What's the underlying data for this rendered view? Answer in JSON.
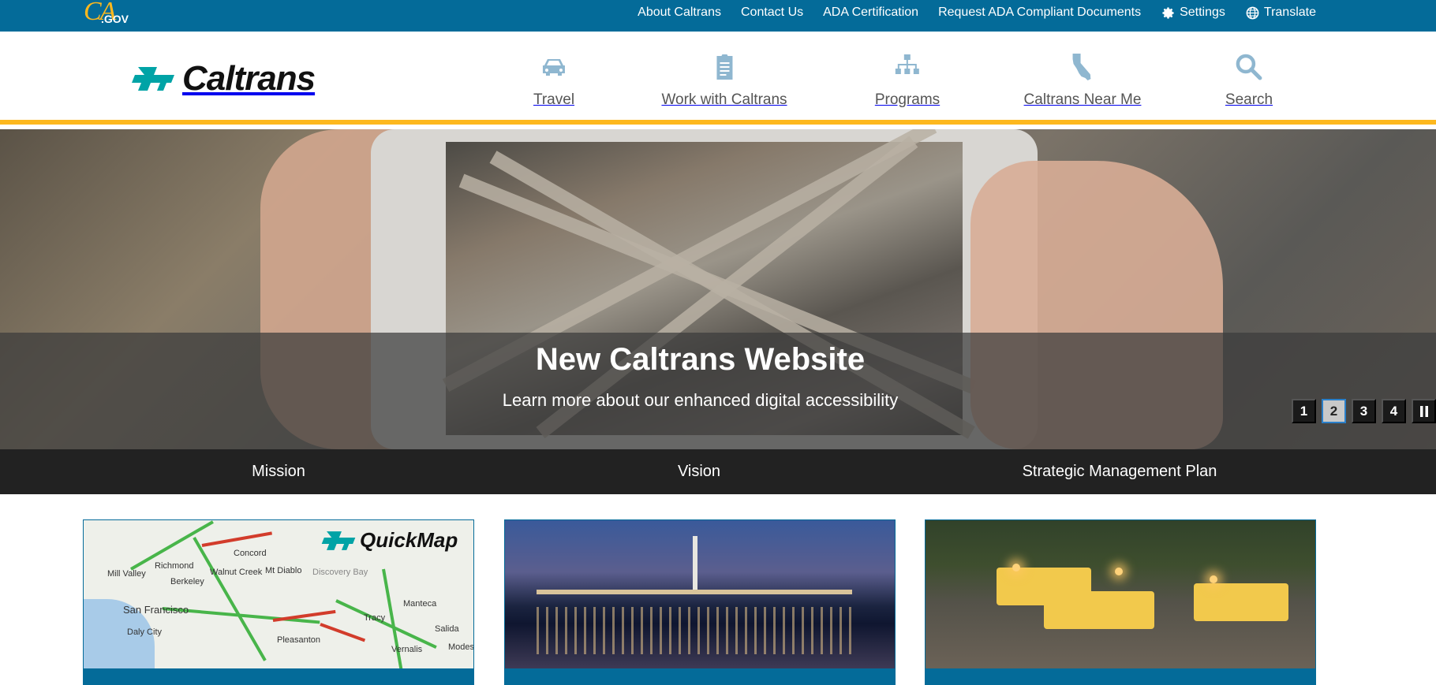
{
  "utility": {
    "logo_text": "CA",
    "logo_gov": ".GOV",
    "links": [
      {
        "label": "About Caltrans",
        "icon": null
      },
      {
        "label": "Contact Us",
        "icon": null
      },
      {
        "label": "ADA Certification",
        "icon": null
      },
      {
        "label": "Request ADA Compliant Documents",
        "icon": null
      },
      {
        "label": "Settings",
        "icon": "gear-icon"
      },
      {
        "label": "Translate",
        "icon": "globe-icon"
      }
    ]
  },
  "branding": {
    "logo_text": "Caltrans"
  },
  "nav": {
    "items": [
      {
        "label": "Travel",
        "icon": "car-icon"
      },
      {
        "label": "Work with Caltrans",
        "icon": "clipboard-icon"
      },
      {
        "label": "Programs",
        "icon": "sitemap-icon"
      },
      {
        "label": "Caltrans Near Me",
        "icon": "california-icon"
      },
      {
        "label": "Search",
        "icon": "search-icon"
      }
    ]
  },
  "hero": {
    "title": "New Caltrans Website",
    "subtitle": "Learn more about our enhanced digital accessibility",
    "slides": [
      "1",
      "2",
      "3",
      "4"
    ],
    "active_slide": "2",
    "pause_icon": "pause-icon"
  },
  "sub_nav": {
    "items": [
      "Mission",
      "Vision",
      "Strategic Management Plan"
    ]
  },
  "cards": {
    "quickmap": {
      "logo_text": "QuickMap",
      "labels": {
        "concord": "Concord",
        "richmond": "Richmond",
        "mill_valley": "Mill Valley",
        "berkeley": "Berkeley",
        "walnut_creek": "Walnut Creek",
        "mt_diablo": "Mt Diablo",
        "discovery_bay": "Discovery Bay",
        "san_francisco": "San Francisco",
        "daly_city": "Daly City",
        "pleasanton": "Pleasanton",
        "tracy": "Tracy",
        "manteca": "Manteca",
        "salida": "Salida",
        "vernalis": "Vernalis",
        "modesto": "Modes"
      }
    }
  },
  "colors": {
    "primary": "#046b99",
    "accent": "#fdb81e",
    "nav_icon": "#8fb7d0",
    "dark": "#222222",
    "logo_teal": "#00a3a6"
  }
}
